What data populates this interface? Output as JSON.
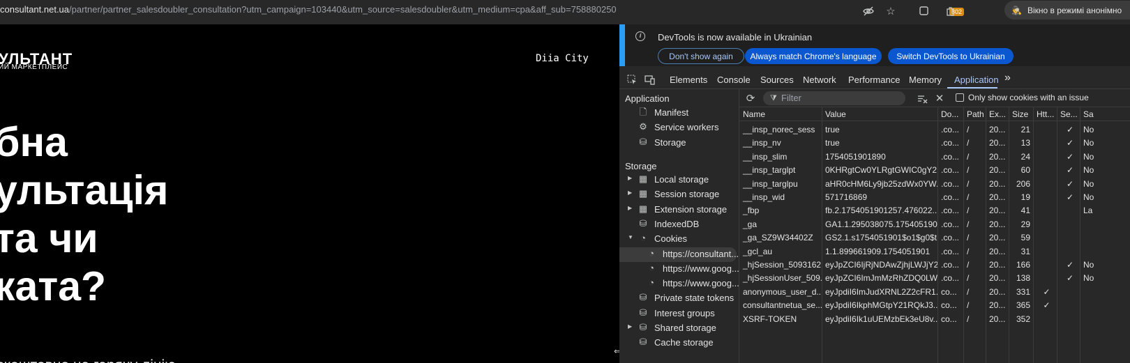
{
  "browser": {
    "url_host": "consultant.net.ua",
    "url_path": "/partner/partner_salesdoubler_consultation?utm_campaign=103440&utm_source=salesdoubler&utm_medium=cpa&aff_sub=758880250",
    "extension_badge": "302",
    "incognito_label": "Вікно в режимі анонімно"
  },
  "page": {
    "logo_main": "УЛЬТАНТ",
    "logo_sub": "ИЙ МАРКЕТПЛЕЙС",
    "diia": "Diia  City",
    "hero_lines": [
      "бна",
      "ультація",
      "та чи",
      "ката?"
    ],
    "subtitle": "зкоштовно на гарячу лінію —"
  },
  "devtools": {
    "info": {
      "text": "DevTools is now available in Ukrainian",
      "btn_dont": "Don't show again",
      "btn_match": "Always match Chrome's language",
      "btn_switch": "Switch DevTools to Ukrainian"
    },
    "tabs": [
      "Elements",
      "Console",
      "Sources",
      "Network",
      "Performance",
      "Memory",
      "Application"
    ],
    "more_tabs": "»",
    "sidebar": {
      "app_head": "Application",
      "app_items": [
        {
          "label": "Manifest",
          "icon": "file-icon"
        },
        {
          "label": "Service workers",
          "icon": "gears-icon"
        },
        {
          "label": "Storage",
          "icon": "database-icon"
        }
      ],
      "storage_head": "Storage",
      "storage_items": [
        {
          "label": "Local storage",
          "icon": "table-icon",
          "expand": true
        },
        {
          "label": "Session storage",
          "icon": "table-icon",
          "expand": true
        },
        {
          "label": "Extension storage",
          "icon": "table-icon",
          "expand": true
        },
        {
          "label": "IndexedDB",
          "icon": "database-icon",
          "expand": false
        },
        {
          "label": "Cookies",
          "icon": "cookie-icon",
          "expand": true,
          "expanded": true
        },
        {
          "label": "https://consultant...",
          "icon": "cookie-icon",
          "child": true,
          "selected": true
        },
        {
          "label": "https://www.goog...",
          "icon": "cookie-icon",
          "child": true
        },
        {
          "label": "https://www.goog...",
          "icon": "cookie-icon",
          "child": true
        },
        {
          "label": "Private state tokens",
          "icon": "database-icon"
        },
        {
          "label": "Interest groups",
          "icon": "database-icon"
        },
        {
          "label": "Shared storage",
          "icon": "database-icon",
          "expand": true
        },
        {
          "label": "Cache storage",
          "icon": "database-icon"
        }
      ]
    },
    "cookies": {
      "filter_placeholder": "Filter",
      "only_issue_label": "Only show cookies with an issue",
      "columns": [
        "Name",
        "Value",
        "Do...",
        "Path",
        "Ex...",
        "Size",
        "Htt...",
        "Se...",
        "Sa"
      ],
      "rows": [
        [
          "__insp_norec_sess",
          "true",
          ".co...",
          "/",
          "20...",
          "21",
          "",
          "✓",
          "No"
        ],
        [
          "__insp_nv",
          "true",
          ".co...",
          "/",
          "20...",
          "13",
          "",
          "✓",
          "No"
        ],
        [
          "__insp_slim",
          "1754051901890",
          ".co...",
          "/",
          "20...",
          "24",
          "",
          "✓",
          "No"
        ],
        [
          "__insp_targlpt",
          "0KHRgtCw0YLRgtGWIC0gY2...",
          ".co...",
          "/",
          "20...",
          "60",
          "",
          "✓",
          "No"
        ],
        [
          "__insp_targlpu",
          "aHR0cHM6Ly9jb25zdWx0YW...",
          ".co...",
          "/",
          "20...",
          "206",
          "",
          "✓",
          "No"
        ],
        [
          "__insp_wid",
          "571716869",
          ".co...",
          "/",
          "20...",
          "19",
          "",
          "✓",
          "No"
        ],
        [
          "_fbp",
          "fb.2.1754051901257.476022...",
          ".co...",
          "/",
          "20...",
          "41",
          "",
          "",
          "La"
        ],
        [
          "_ga",
          "GA1.1.295038075.1754051901",
          ".co...",
          "/",
          "20...",
          "29",
          "",
          "",
          ""
        ],
        [
          "_ga_SZ9W34402Z",
          "GS2.1.s1754051901$o1$g0$t...",
          ".co...",
          "/",
          "20...",
          "59",
          "",
          "",
          ""
        ],
        [
          "_gcl_au",
          "1.1.899661909.1754051901",
          ".co...",
          "/",
          "20...",
          "31",
          "",
          "",
          ""
        ],
        [
          "_hjSession_5093162",
          "eyJpZCI6IjRjNDAwZjhjLWJjY2...",
          ".co...",
          "/",
          "20...",
          "166",
          "",
          "✓",
          "No"
        ],
        [
          "_hjSessionUser_509...",
          "eyJpZCI6ImJmMzRhZDQ0LW...",
          ".co...",
          "/",
          "20...",
          "138",
          "",
          "✓",
          "No"
        ],
        [
          "anonymous_user_d...",
          "eyJpdiI6ImJudXRNL2Z2cFR1...",
          "co...",
          "/",
          "20...",
          "331",
          "✓",
          "",
          ""
        ],
        [
          "consultantnetua_se...",
          "eyJpdiI6IkphMGtpY21RQkJ3...",
          "co...",
          "/",
          "20...",
          "365",
          "✓",
          "",
          ""
        ],
        [
          "XSRF-TOKEN",
          "eyJpdiI6Ik1uUEMzbEk3eU8v...",
          "co...",
          "/",
          "20...",
          "352",
          "",
          "",
          ""
        ]
      ]
    }
  }
}
